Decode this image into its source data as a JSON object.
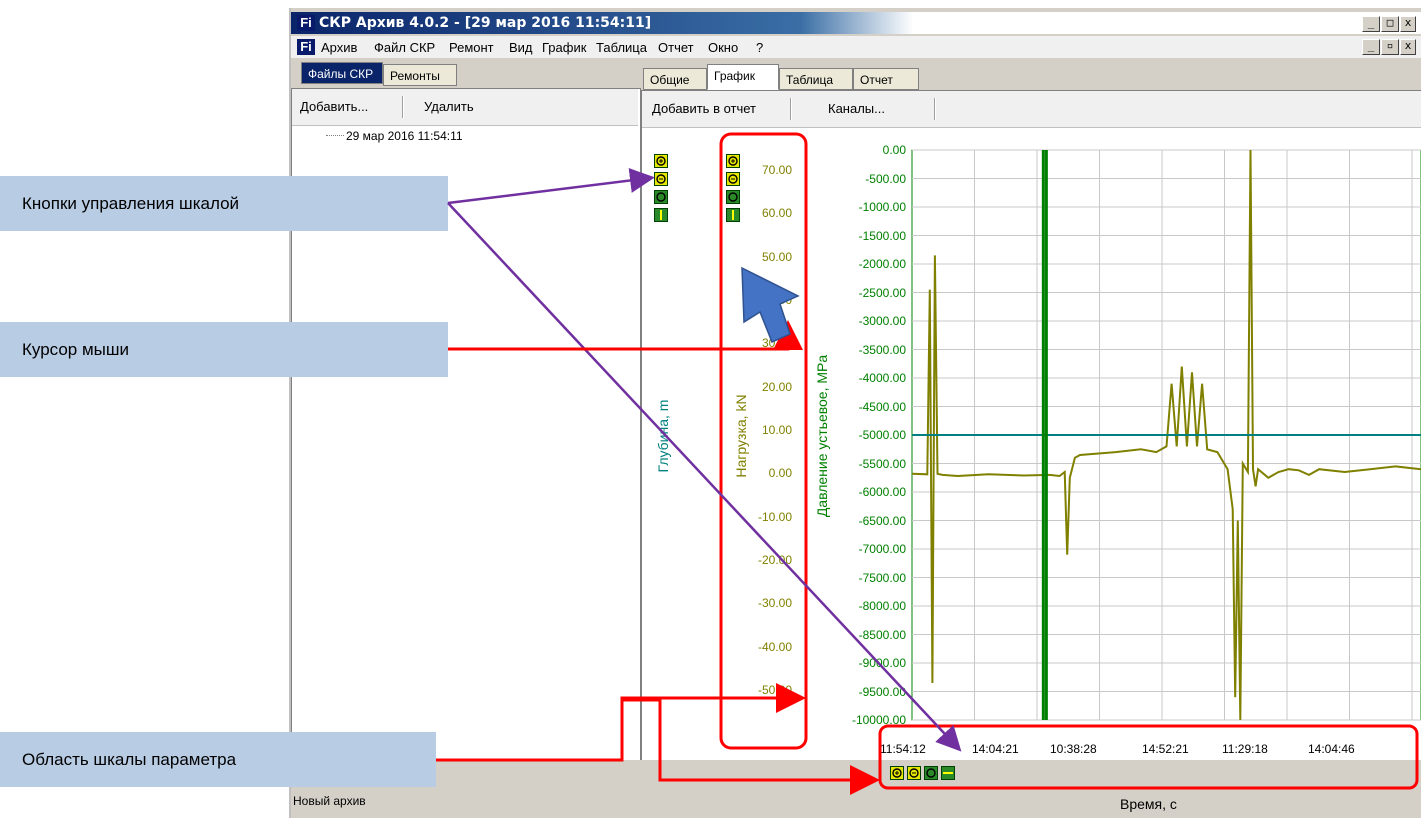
{
  "window": {
    "title": "СКР Архив 4.0.2 - [29 мар 2016 11:54:11]",
    "logo": "Fi"
  },
  "menu": [
    "Архив",
    "Файл СКР",
    "Ремонт",
    "Вид",
    "График",
    "Таблица",
    "Отчет",
    "Окно",
    "?"
  ],
  "left": {
    "tabs": [
      "Файлы СКР",
      "Ремонты"
    ],
    "toolbar": {
      "add": "Добавить...",
      "delete": "Удалить"
    },
    "tree_item": "29 мар 2016 11:54:11"
  },
  "right": {
    "tabs": [
      "Общие",
      "График",
      "Таблица",
      "Отчет"
    ],
    "toolbar": {
      "add_to_report": "Добавить в отчет",
      "channels": "Каналы..."
    }
  },
  "status": "Новый архив",
  "callouts": {
    "scale_buttons": "Кнопки управления шкалой",
    "cursor": "Курсор мыши",
    "scale_area": "Область шкалы параметра"
  },
  "icons": [
    "zoom-in-icon",
    "zoom-out-icon",
    "zoom-reset-icon",
    "fit-vertical-icon",
    "fit-horizontal-icon",
    "cursor-arrow-icon"
  ],
  "colors": {
    "load": "#808000",
    "depth": "#008080",
    "pressure": "#008000",
    "highlight": "#ff0000",
    "arrow": "#7030a0",
    "callout": "#b8cce4",
    "cursor": "#4472c4"
  },
  "chart_data": {
    "type": "line",
    "xlabel": "Время, с",
    "x_ticks": [
      "11:54:12",
      "14:04:21",
      "10:38:28",
      "14:52:21",
      "11:29:18",
      "14:04:46"
    ],
    "axes": [
      {
        "label": "Глубина, m",
        "ticks": []
      },
      {
        "label": "Нагрузка, kN",
        "ticks": [
          "70.00",
          "60.00",
          "50.00",
          "40.00",
          "30.00",
          "20.00",
          "10.00",
          "0.00",
          "-10.00",
          "-20.00",
          "-30.00",
          "-40.00",
          "-50.00"
        ],
        "ylim": [
          -50,
          70
        ]
      },
      {
        "label": "Давление устьевое, MPa",
        "ticks": [
          "0.00",
          "-500.00",
          "-1000.00",
          "-1500.00",
          "-2000.00",
          "-2500.00",
          "-3000.00",
          "-3500.00",
          "-4000.00",
          "-4500.00",
          "-5000.00",
          "-5500.00",
          "-6000.00",
          "-6500.00",
          "-7000.00",
          "-7500.00",
          "-8000.00",
          "-8500.00",
          "-9000.00",
          "-9500.00",
          "-10000.00"
        ],
        "ylim": [
          -10000,
          0
        ]
      }
    ],
    "grid": true,
    "series": [
      {
        "values_x": [
          0,
          0.03,
          0.035,
          0.04,
          0.045,
          0.05,
          0.06,
          0.09,
          0.15,
          0.22,
          0.27,
          0.29,
          0.3,
          0.305,
          0.31,
          0.32,
          0.33,
          0.4,
          0.45,
          0.48,
          0.5,
          0.51,
          0.52,
          0.53,
          0.54,
          0.55,
          0.56,
          0.57,
          0.58,
          0.6,
          0.62,
          0.63,
          0.635,
          0.64,
          0.645,
          0.65,
          0.66,
          0.665,
          0.67,
          0.675,
          0.68,
          0.7,
          0.72,
          0.74,
          0.76,
          0.78,
          0.8,
          0.85,
          0.9,
          0.95,
          1.0
        ],
        "values": [
          -5680,
          -5690,
          -2450,
          -9350,
          -1850,
          -5680,
          -5700,
          -5720,
          -5690,
          -5710,
          -5700,
          -5720,
          -5650,
          -7100,
          -5750,
          -5400,
          -5350,
          -5300,
          -5250,
          -5300,
          -5200,
          -4100,
          -5200,
          -3800,
          -5200,
          -3900,
          -5200,
          -4100,
          -5250,
          -5300,
          -5600,
          -6300,
          -9600,
          -6500,
          -10000,
          -5500,
          -5650,
          0,
          -5600,
          -5900,
          -5600,
          -5750,
          -5650,
          -5600,
          -5620,
          -5700,
          -5600,
          -5650,
          -5600,
          -5550,
          -5600
        ]
      },
      {
        "values_x": [
          0,
          1
        ],
        "values": [
          -5000,
          -5000
        ]
      }
    ],
    "markers_x": [
      0.258,
      0.264
    ]
  }
}
